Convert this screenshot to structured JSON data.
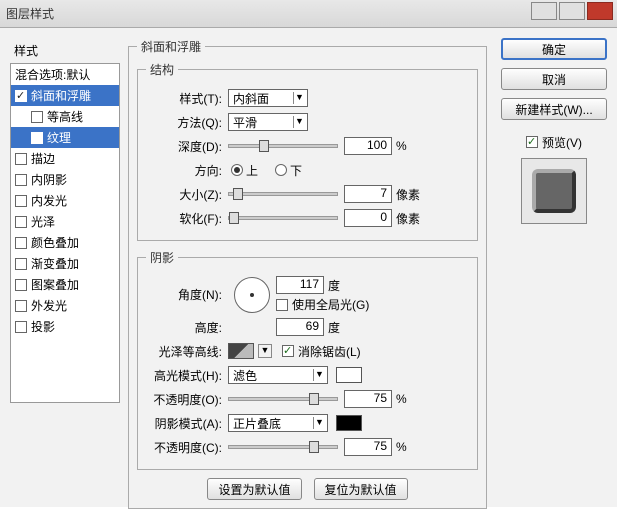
{
  "window": {
    "title": "图层样式"
  },
  "sidebar": {
    "header": "样式",
    "items": [
      {
        "label": "混合选项:默认"
      },
      {
        "label": "斜面和浮雕"
      },
      {
        "label": "等高线"
      },
      {
        "label": "纹理"
      },
      {
        "label": "描边"
      },
      {
        "label": "内阴影"
      },
      {
        "label": "内发光"
      },
      {
        "label": "光泽"
      },
      {
        "label": "颜色叠加"
      },
      {
        "label": "渐变叠加"
      },
      {
        "label": "图案叠加"
      },
      {
        "label": "外发光"
      },
      {
        "label": "投影"
      }
    ]
  },
  "bevel": {
    "group_title": "斜面和浮雕",
    "struct_title": "结构",
    "style_label": "样式(T):",
    "style_value": "内斜面",
    "method_label": "方法(Q):",
    "method_value": "平滑",
    "depth_label": "深度(D):",
    "depth_value": "100",
    "depth_unit": "%",
    "direction_label": "方向:",
    "up_label": "上",
    "down_label": "下",
    "size_label": "大小(Z):",
    "size_value": "7",
    "size_unit": "像素",
    "soften_label": "软化(F):",
    "soften_value": "0",
    "soften_unit": "像素"
  },
  "shading": {
    "title": "阴影",
    "angle_label": "角度(N):",
    "angle_value": "117",
    "deg1": "度",
    "global_label": "使用全局光(G)",
    "altitude_label": "高度:",
    "altitude_value": "69",
    "deg2": "度",
    "gloss_label": "光泽等高线:",
    "antialias_label": "消除锯齿(L)",
    "highlight_mode_label": "高光模式(H):",
    "highlight_mode_value": "滤色",
    "highlight_opacity_label": "不透明度(O):",
    "highlight_opacity_value": "75",
    "pct1": "%",
    "shadow_mode_label": "阴影模式(A):",
    "shadow_mode_value": "正片叠底",
    "shadow_opacity_label": "不透明度(C):",
    "shadow_opacity_value": "75",
    "pct2": "%"
  },
  "bottom": {
    "make_default": "设置为默认值",
    "reset_default": "复位为默认值"
  },
  "right": {
    "ok": "确定",
    "cancel": "取消",
    "new_style": "新建样式(W)...",
    "preview": "预览(V)"
  }
}
